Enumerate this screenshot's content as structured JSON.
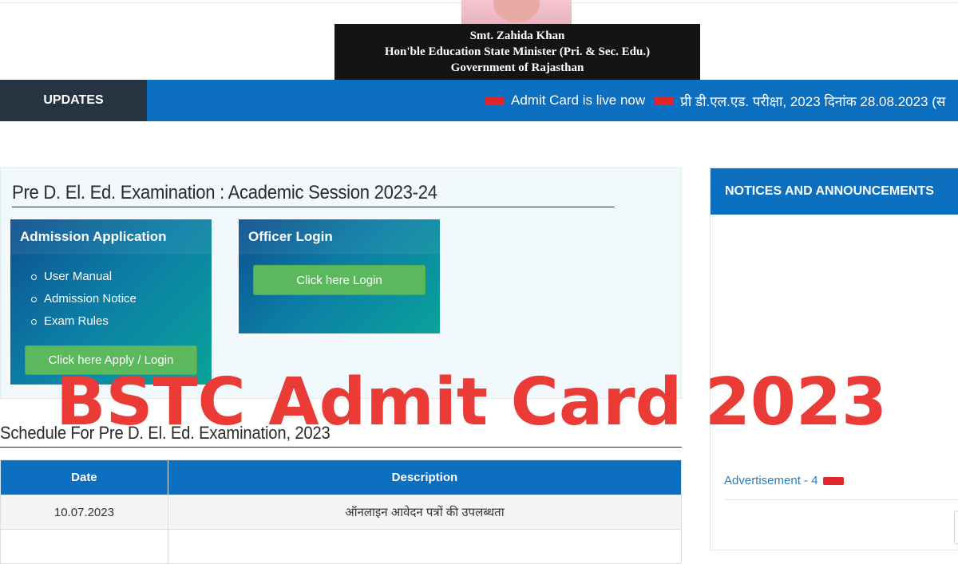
{
  "header": {
    "minister_name": "Smt. Zahida Khan",
    "minister_title": "Hon'ble Education State Minister (Pri. & Sec. Edu.)",
    "government": "Government of Rajasthan"
  },
  "updates": {
    "label": "UPDATES",
    "ticker": [
      "Admit Card is live now",
      "प्री डी.एल.एड. परीक्षा, 2023 दिनांक 28.08.2023 (स"
    ]
  },
  "main": {
    "title": "Pre D. El. Ed. Examination : Academic Session 2023-24",
    "admission": {
      "heading": "Admission Application",
      "items": [
        "User Manual",
        "Admission Notice",
        "Exam Rules"
      ],
      "button": "Click here Apply / Login"
    },
    "officer": {
      "heading": "Officer Login",
      "button": "Click here Login"
    }
  },
  "schedule": {
    "title": "Schedule For Pre D. El. Ed. Examination, 2023",
    "columns": [
      "Date",
      "Description"
    ],
    "rows": [
      {
        "date": "10.07.2023",
        "description": "ऑनलाइन आवेदन पत्रों की उपलब्धता"
      }
    ]
  },
  "notices": {
    "heading": "NOTICES AND ANNOUNCEMENTS",
    "advertisement": "Advertisement - 4"
  },
  "overlay": {
    "headline": "BSTC Admit Card 2023"
  },
  "colors": {
    "primary_blue": "#0c6fc0",
    "updates_label_bg": "#263341",
    "green_button": "#5bb85d",
    "headline_red": "#ea3b36",
    "new_badge_red": "#e0262a"
  }
}
